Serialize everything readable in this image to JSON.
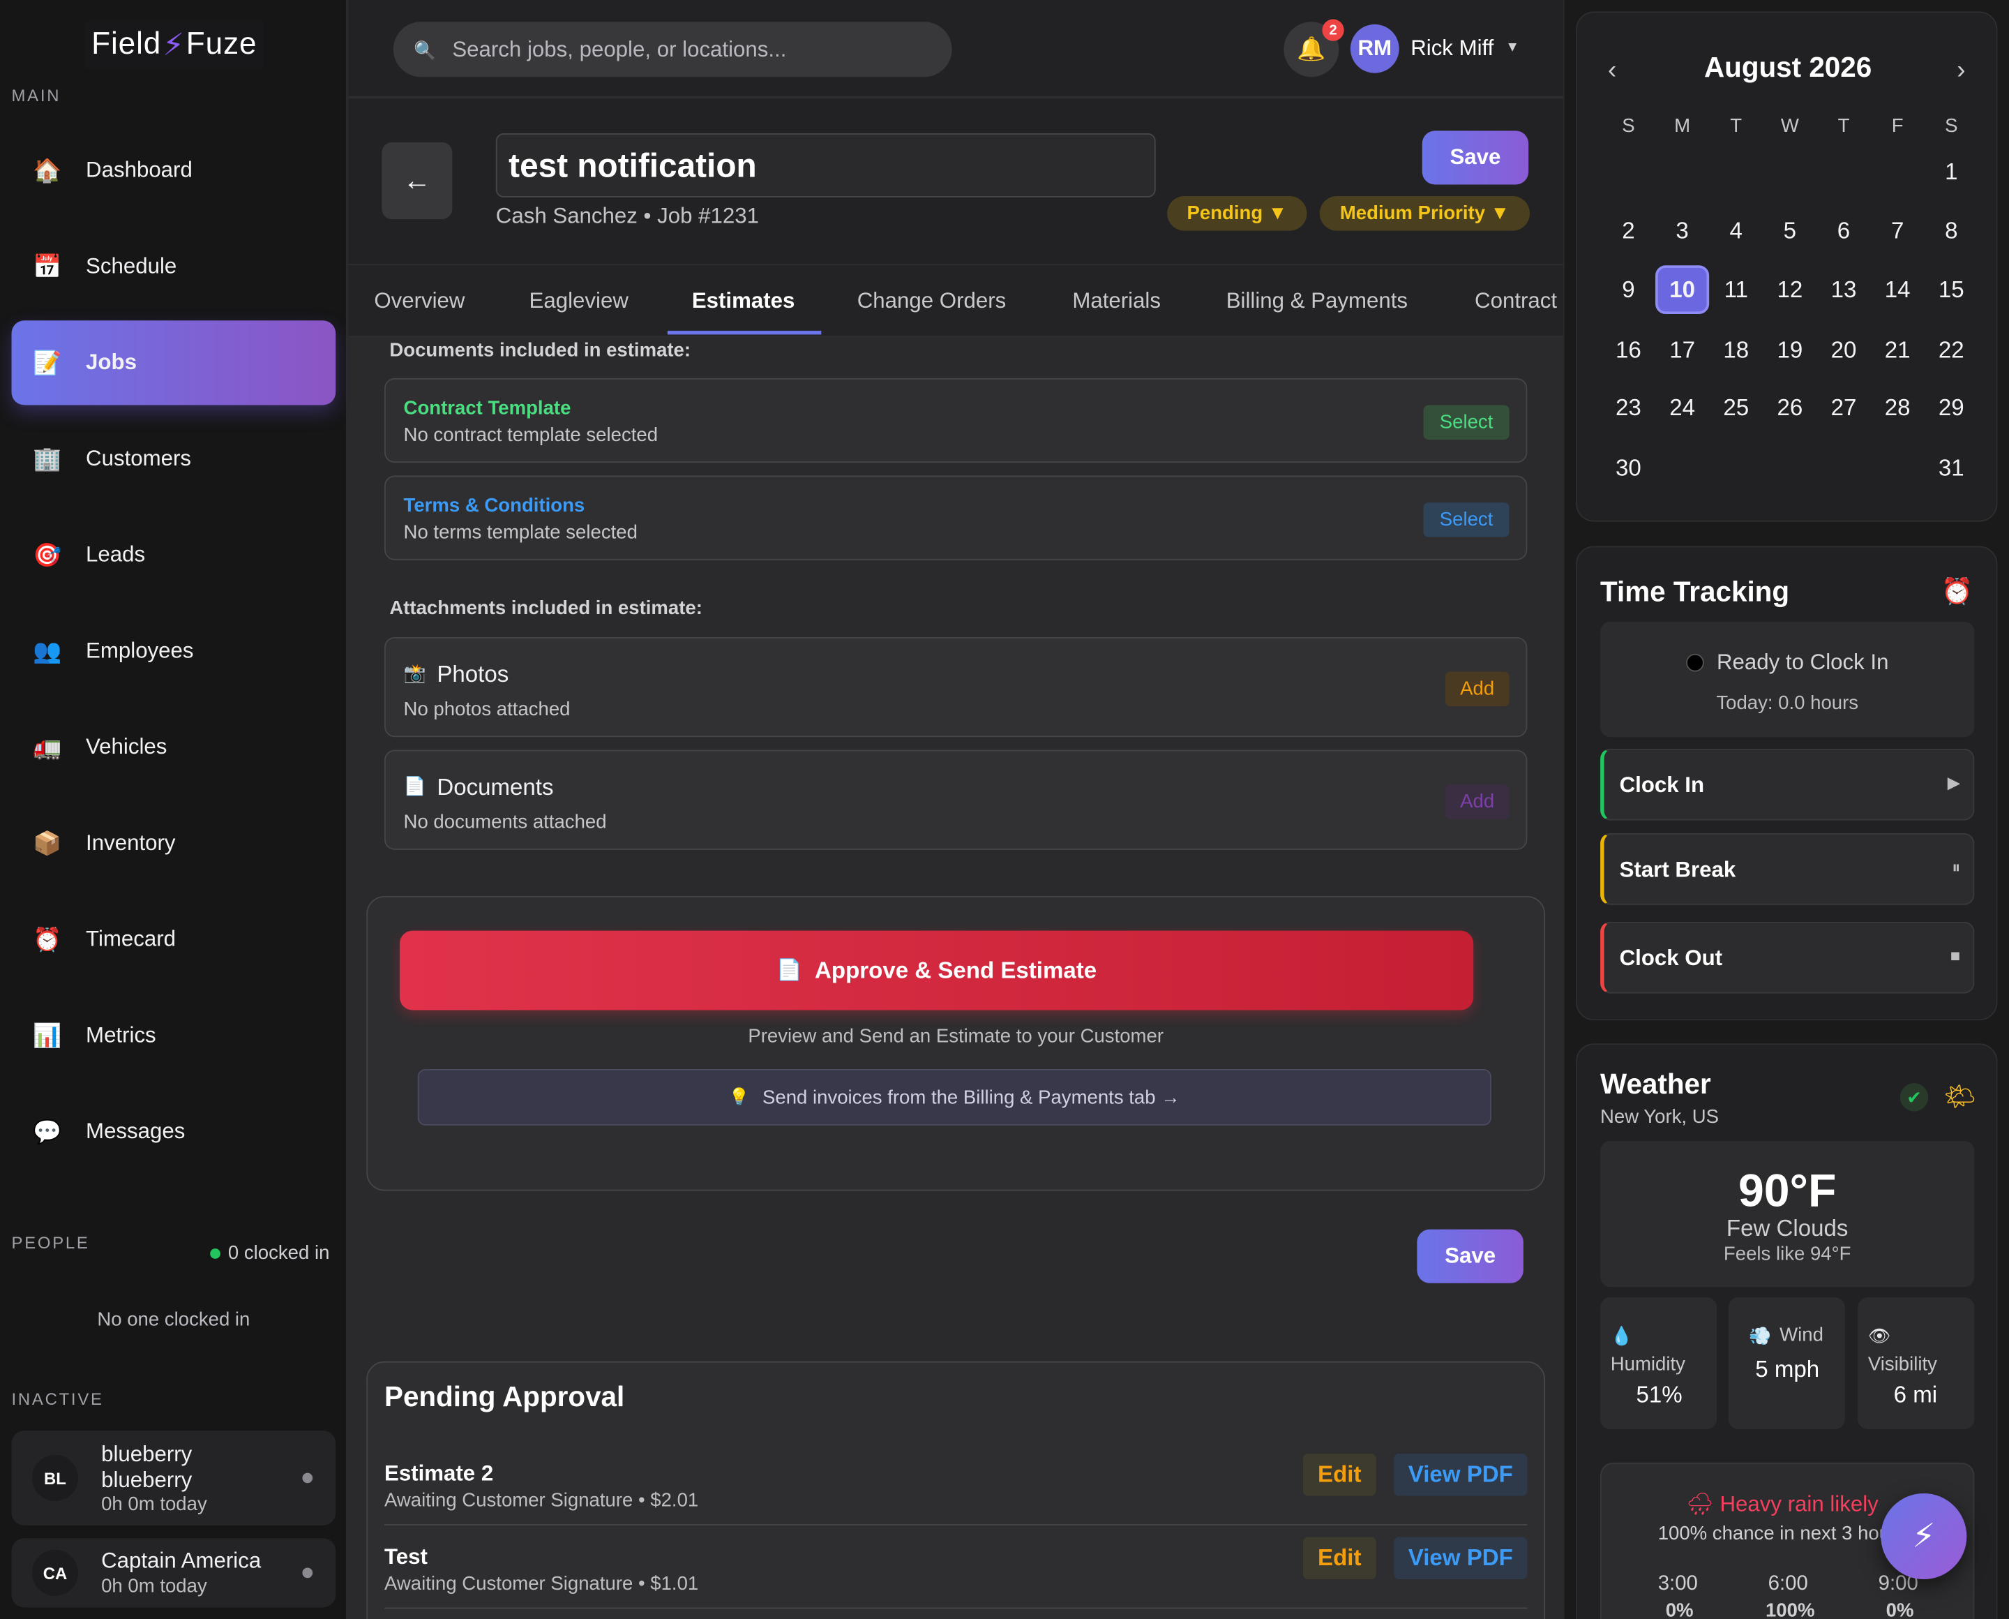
{
  "brand": {
    "name_left": "Field",
    "name_right": "Fuze"
  },
  "sidebar": {
    "main_label": "MAIN",
    "items": [
      {
        "label": "Dashboard",
        "icon": "house-icon"
      },
      {
        "label": "Schedule",
        "icon": "calendar-icon"
      },
      {
        "label": "Jobs",
        "icon": "memo-icon"
      },
      {
        "label": "Customers",
        "icon": "office-building-icon"
      },
      {
        "label": "Leads",
        "icon": "target-icon"
      },
      {
        "label": "Employees",
        "icon": "people-icon"
      },
      {
        "label": "Vehicles",
        "icon": "truck-icon"
      },
      {
        "label": "Inventory",
        "icon": "package-icon"
      },
      {
        "label": "Timecard",
        "icon": "alarm-clock-icon"
      },
      {
        "label": "Metrics",
        "icon": "bar-chart-icon"
      },
      {
        "label": "Messages",
        "icon": "speech-bubble-icon"
      }
    ],
    "people_label": "PEOPLE",
    "clocked_in": "0 clocked in",
    "no_one": "No one clocked in",
    "inactive_label": "INACTIVE",
    "inactive": [
      {
        "initials": "BL",
        "name": "blueberry blueberry",
        "time": "0h 0m today"
      },
      {
        "initials": "CA",
        "name": "Captain America",
        "time": "0h 0m today"
      }
    ]
  },
  "topbar": {
    "search_placeholder": "Search jobs, people, or locations...",
    "notifications": "2",
    "user_initials": "RM",
    "user_name": "Rick Miff"
  },
  "job": {
    "title": "test notification",
    "subtitle": "Cash Sanchez • Job #1231",
    "save": "Save",
    "status": "Pending ▼",
    "priority": "Medium Priority ▼"
  },
  "tabs": [
    "Overview",
    "Eagleview",
    "Estimates",
    "Change Orders",
    "Materials",
    "Billing & Payments",
    "Contract"
  ],
  "active_tab": "Estimates",
  "estimate": {
    "documents_label": "Documents included in estimate:",
    "contract": {
      "title": "Contract Template",
      "status": "No contract template selected",
      "button": "Select"
    },
    "terms": {
      "title": "Terms & Conditions",
      "status": "No terms template selected",
      "button": "Select"
    },
    "attachments_label": "Attachments included in estimate:",
    "photos": {
      "title": "Photos",
      "status": "No photos attached",
      "button": "Add"
    },
    "documents": {
      "title": "Documents",
      "status": "No documents attached",
      "button": "Add"
    },
    "approve_button": "Approve & Send Estimate",
    "preview_text": "Preview and Send an Estimate to your Customer",
    "info_text": "Send invoices from the Billing & Payments tab →",
    "save": "Save"
  },
  "pending": {
    "title": "Pending Approval",
    "rows": [
      {
        "name": "Estimate 2",
        "status": "Awaiting Customer Signature • $2.01",
        "edit": "Edit",
        "view": "View PDF"
      },
      {
        "name": "Test",
        "status": "Awaiting Customer Signature • $1.01",
        "edit": "Edit",
        "view": "View PDF"
      }
    ]
  },
  "calendar": {
    "month": "August 2026",
    "dow": [
      "S",
      "M",
      "T",
      "W",
      "T",
      "F",
      "S"
    ],
    "today": 10,
    "weeks": [
      [
        "",
        "",
        "",
        "",
        "",
        "",
        "1"
      ],
      [
        "2",
        "3",
        "4",
        "5",
        "6",
        "7",
        "8"
      ],
      [
        "9",
        "10",
        "11",
        "12",
        "13",
        "14",
        "15"
      ],
      [
        "16",
        "17",
        "18",
        "19",
        "20",
        "21",
        "22"
      ],
      [
        "23",
        "24",
        "25",
        "26",
        "27",
        "28",
        "29"
      ],
      [
        "30",
        "",
        "",
        "",
        "",
        "",
        "31"
      ]
    ]
  },
  "time_tracking": {
    "title": "Time Tracking",
    "status": "Ready to Clock In",
    "today": "Today: 0.0 hours",
    "buttons": [
      {
        "label": "Clock In",
        "icon": "▶",
        "color": "#22c55e"
      },
      {
        "label": "Start Break",
        "icon": "⏸",
        "color": "#eab308"
      },
      {
        "label": "Clock Out",
        "icon": "■",
        "color": "#ef4444"
      }
    ]
  },
  "weather": {
    "title": "Weather",
    "location": "New York, US",
    "temp": "90°F",
    "condition": "Few Clouds",
    "feels": "Feels like 94°F",
    "tiles": [
      {
        "label": "Humidity",
        "value": "51%",
        "icon": "droplet-icon"
      },
      {
        "label": "Wind",
        "value": "5 mph",
        "icon": "wind-icon"
      },
      {
        "label": "Visibility",
        "value": "6 mi",
        "icon": "eye-icon"
      }
    ],
    "rain_alert": "Heavy rain likely",
    "rain_sub": "100% chance in next 3 hours",
    "hours": [
      {
        "time": "3:00",
        "pct": "0%"
      },
      {
        "time": "6:00",
        "pct": "100%"
      },
      {
        "time": "9:00",
        "pct": "0%"
      }
    ]
  }
}
